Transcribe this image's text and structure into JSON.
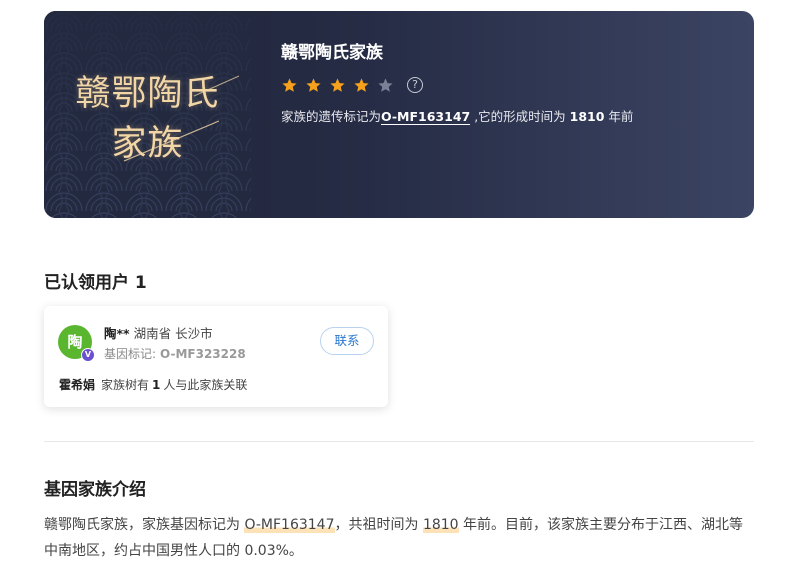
{
  "banner": {
    "cover_line1": "赣鄂陶氏",
    "cover_line2": "家族",
    "title": "赣鄂陶氏家族",
    "rating": 4,
    "rating_max": 5,
    "help_icon": "?",
    "desc_prefix": "家族的遗传标记为",
    "marker": "O-MF163147",
    "desc_middle": " ,它的形成时间为 ",
    "years": "1810",
    "desc_suffix": " 年前"
  },
  "claimed": {
    "title": "已认领用户 1",
    "user": {
      "avatar_char": "陶",
      "badge": "V",
      "name": "陶**",
      "province": "湖南省",
      "city": "长沙市",
      "marker_label": "基因标记:",
      "marker_value": "O-MF323228",
      "contact_label": "联系",
      "owner": "霍希娟",
      "tree_prefix": "家族树有",
      "tree_count": "1",
      "tree_suffix": "人与此家族关联"
    }
  },
  "intro": {
    "title": "基因家族介绍",
    "p1": "赣鄂陶氏家族，家族基因标记为 ",
    "marker": "O-MF163147",
    "p2": "，共祖时间为 ",
    "years": "1810",
    "p3": " 年前。目前，该家族主要分布于江西、湖北等中南地区，约占中国男性人口的 0.03%。"
  },
  "colors": {
    "star_on": "#f5a11c",
    "star_off": "#7a8096",
    "avatar_bg": "#5ab52f",
    "contact_blue": "#2a78d0"
  }
}
